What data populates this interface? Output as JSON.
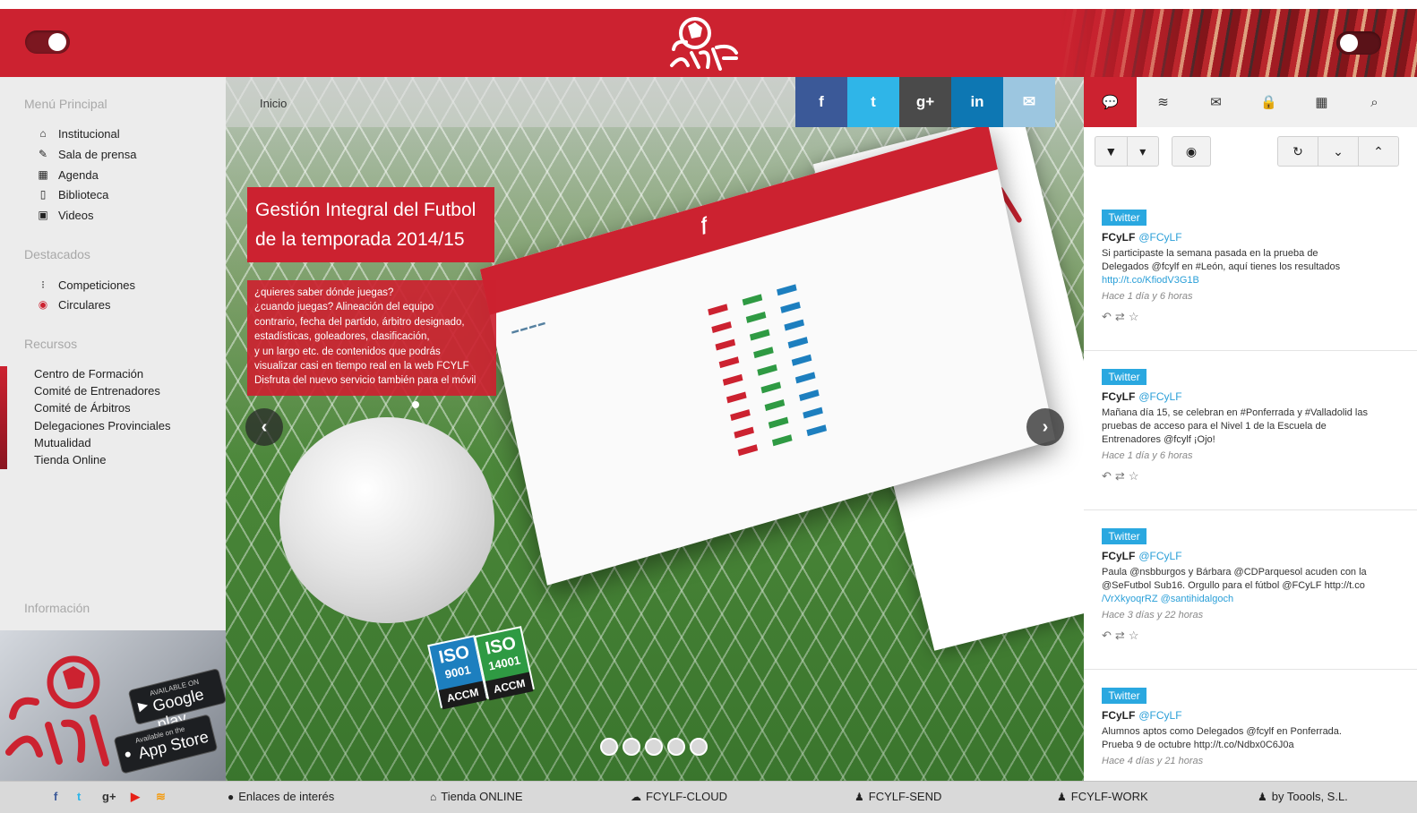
{
  "brand": {
    "name": "fcylf",
    "color": "#cc2230"
  },
  "topbar": {
    "left_toggle": "toggle",
    "right_toggle": "toggle"
  },
  "sidebar": {
    "menu_title": "Menú Principal",
    "menu": [
      {
        "icon": "home-icon",
        "label": "Institucional"
      },
      {
        "icon": "pencil-icon",
        "label": "Sala de prensa"
      },
      {
        "icon": "calendar-icon",
        "label": "Agenda"
      },
      {
        "icon": "book-icon",
        "label": "Biblioteca"
      },
      {
        "icon": "film-icon",
        "label": "Videos"
      }
    ],
    "featured_title": "Destacados",
    "featured": [
      {
        "icon": "dots-icon",
        "label": "Competiciones"
      },
      {
        "icon": "circle-icon",
        "label": "Circulares"
      }
    ],
    "resources_title": "Recursos",
    "resources": [
      "Centro de Formación",
      "Comité de Entrenadores",
      "Comité de Árbitros",
      "Delegaciones Provinciales",
      "Mutualidad",
      "Tienda Online"
    ],
    "info_title": "Información",
    "apps": {
      "google_small": "AVAILABLE ON",
      "google_big": "Google play",
      "apple_small": "Available on the",
      "apple_big": "App Store"
    }
  },
  "breadcrumb": "Inicio",
  "social": [
    {
      "icon": "facebook-icon",
      "glyph": "f",
      "color": "#3b5998"
    },
    {
      "icon": "twitter-icon",
      "glyph": "t",
      "color": "#2fb5e8"
    },
    {
      "icon": "googleplus-icon",
      "glyph": "g+",
      "color": "#4a4a4a"
    },
    {
      "icon": "linkedin-icon",
      "glyph": "in",
      "color": "#0d77b3"
    },
    {
      "icon": "mail-icon",
      "glyph": "✉",
      "color": "#9cc6e0"
    }
  ],
  "slide": {
    "headline": [
      "Gestión Integral del Futbol",
      "de la temporada 2014/15"
    ],
    "description": [
      "¿quieres saber dónde juegas?",
      "¿cuando juegas? Alineación del equipo",
      "contrario, fecha del partido, árbitro designado,",
      "estadísticas, goleadores, clasificación,",
      "y un largo etc. de contenidos que podrás",
      "visualizar casi en tiempo real en la web FCYLF",
      "Disfruta del nuevo servicio también para el móvil"
    ],
    "iso": [
      {
        "title": "ISO",
        "number": "9001",
        "label": "ACCM",
        "color": "#1d7fbf"
      },
      {
        "title": "ISO",
        "number": "14001",
        "label": "ACCM",
        "color": "#2f9a43"
      }
    ],
    "dots": 5
  },
  "tools": [
    {
      "icon": "comment-icon",
      "active": true
    },
    {
      "icon": "rss-icon",
      "active": false
    },
    {
      "icon": "envelope-icon",
      "active": false
    },
    {
      "icon": "lock-icon",
      "active": false
    },
    {
      "icon": "calendar-icon",
      "active": false
    },
    {
      "icon": "search-icon",
      "active": false
    }
  ],
  "twitter": {
    "badge": "Twitter",
    "controls_left": [
      "filter-icon",
      "caret-down-icon"
    ],
    "controls_mid": [
      "eye-icon"
    ],
    "controls_right": [
      "refresh-icon",
      "chevron-down-icon",
      "chevron-up-icon"
    ],
    "tweets": [
      {
        "author": "FCyLF",
        "handle": "@FCyLF",
        "lines": [
          "Si participaste la semana pasada en la prueba de",
          "Delegados @fcylf en #León, aquí tienes los resultados",
          "http://t.co/KfiodV3G1B"
        ],
        "time": "Hace 1 día y 6 horas"
      },
      {
        "author": "FCyLF",
        "handle": "@FCyLF",
        "lines": [
          "Mañana día 15, se celebran en #Ponferrada y #Valladolid las",
          "pruebas de acceso para el Nivel 1 de la Escuela de",
          "Entrenadores @fcylf ¡Ojo!"
        ],
        "time": "Hace 1 día y 6 horas"
      },
      {
        "author": "FCyLF",
        "handle": "@FCyLF",
        "lines": [
          "Paula @nsbburgos y Bárbara @CDParquesol acuden con la",
          "@SeFutbol Sub16. Orgullo para el fútbol @FCyLF http://t.co",
          "/VrXkyoqrRZ @santihidalgoch"
        ],
        "time": "Hace 3 días y 22 horas"
      },
      {
        "author": "FCyLF",
        "handle": "@FCyLF",
        "lines": [
          "Alumnos aptos como Delegados @fcylf en Ponferrada.",
          "Prueba 9 de octubre http://t.co/Ndbx0C6J0a"
        ],
        "time": "Hace 4 días y 21 horas"
      }
    ]
  },
  "footer": {
    "social": [
      {
        "icon": "facebook-icon",
        "glyph": "f",
        "color": "#3b5998"
      },
      {
        "icon": "twitter-icon",
        "glyph": "t",
        "color": "#2fb5e8"
      },
      {
        "icon": "googleplus-icon",
        "glyph": "g+",
        "color": "#333333"
      },
      {
        "icon": "youtube-icon",
        "glyph": "▶",
        "color": "#e62117"
      },
      {
        "icon": "rss-icon",
        "glyph": "≋",
        "color": "#f39c12"
      }
    ],
    "links": [
      {
        "icon": "user-icon",
        "glyph": "👤",
        "label": "Enlaces de interés"
      },
      {
        "icon": "home-icon",
        "glyph": "⌂",
        "label": "Tienda ONLINE"
      },
      {
        "icon": "cloud-icon",
        "glyph": "☁",
        "label": "FCYLF-CLOUD"
      },
      {
        "icon": "group-icon",
        "glyph": "♟",
        "label": "FCYLF-SEND"
      },
      {
        "icon": "group-icon",
        "glyph": "♟",
        "label": "FCYLF-WORK"
      },
      {
        "icon": "group-icon",
        "glyph": "♟",
        "label": "by Toools, S.L."
      }
    ]
  }
}
